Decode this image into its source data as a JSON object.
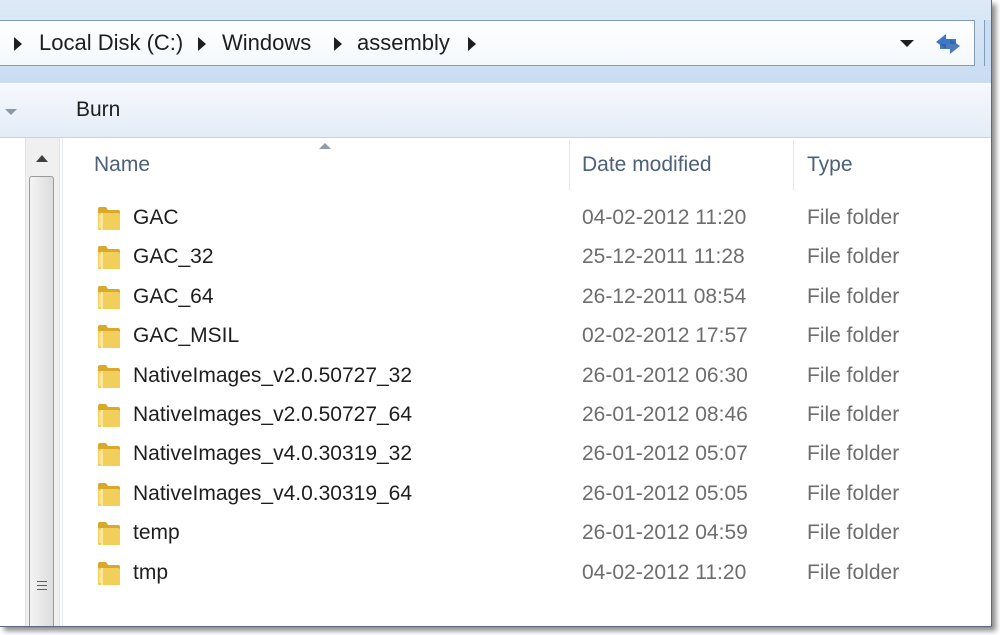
{
  "address_bar": {
    "crumbs": [
      "Local Disk (C:)",
      "Windows",
      "assembly"
    ],
    "dropdown_icon": "chevron-down-icon",
    "refresh_icon": "refresh-icon"
  },
  "toolbar": {
    "burn_label": "Burn"
  },
  "columns": {
    "name": "Name",
    "date_modified": "Date modified",
    "type": "Type"
  },
  "files": [
    {
      "name": "GAC",
      "date": "04-02-2012 11:20",
      "type": "File folder"
    },
    {
      "name": "GAC_32",
      "date": "25-12-2011 11:28",
      "type": "File folder"
    },
    {
      "name": "GAC_64",
      "date": "26-12-2011 08:54",
      "type": "File folder"
    },
    {
      "name": "GAC_MSIL",
      "date": "02-02-2012 17:57",
      "type": "File folder"
    },
    {
      "name": "NativeImages_v2.0.50727_32",
      "date": "26-01-2012 06:30",
      "type": "File folder"
    },
    {
      "name": "NativeImages_v2.0.50727_64",
      "date": "26-01-2012 08:46",
      "type": "File folder"
    },
    {
      "name": "NativeImages_v4.0.30319_32",
      "date": "26-01-2012 05:07",
      "type": "File folder"
    },
    {
      "name": "NativeImages_v4.0.30319_64",
      "date": "26-01-2012 05:05",
      "type": "File folder"
    },
    {
      "name": "temp",
      "date": "26-01-2012 04:59",
      "type": "File folder"
    },
    {
      "name": "tmp",
      "date": "04-02-2012 11:20",
      "type": "File folder"
    }
  ],
  "colors": {
    "address_bg": "#c9dcf1",
    "folder_yellow": "#f2cf5b",
    "header_text": "#4c607a",
    "meta_text": "#6d6d6d"
  }
}
